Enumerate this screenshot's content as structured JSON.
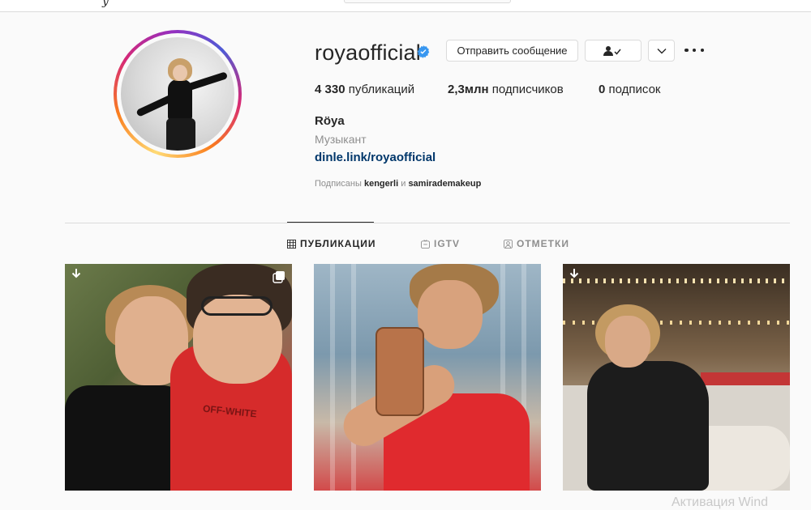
{
  "topbar": {
    "logo_tail": "y"
  },
  "profile": {
    "username": "royaofficial",
    "verified_icon": "verified-badge-icon",
    "buttons": {
      "message": "Отправить сообщение",
      "follow_icon": "person-check-icon",
      "more_icon": "chevron-down-icon",
      "options_icon": "ellipsis-icon"
    },
    "stats": {
      "posts_count": "4 330",
      "posts_label": "публикаций",
      "followers_count": "2,3млн",
      "followers_label": "подписчиков",
      "following_count": "0",
      "following_label": "подписок"
    },
    "full_name": "Röya",
    "category": "Музыкант",
    "bio_link": "dinle.link/royaofficial",
    "followed_by": {
      "prefix": "Подписаны",
      "user1": "kengerli",
      "joiner": "и",
      "user2": "samirademakeup"
    }
  },
  "tabs": [
    {
      "label": "ПУБЛИКАЦИИ",
      "icon": "grid-icon",
      "active": true
    },
    {
      "label": "IGTV",
      "icon": "igtv-icon",
      "active": false
    },
    {
      "label": "ОТМЕТКИ",
      "icon": "tagged-icon",
      "active": false
    }
  ],
  "posts": [
    {
      "id": "post-1",
      "badge": "multiple-photos-icon"
    },
    {
      "id": "post-2",
      "badge": ""
    },
    {
      "id": "post-3",
      "badge": ""
    }
  ],
  "watermark": "Активация Wind",
  "colors": {
    "link": "#00376b",
    "verified": "#3897f0",
    "muted": "#8e8e8e",
    "text": "#262626"
  }
}
